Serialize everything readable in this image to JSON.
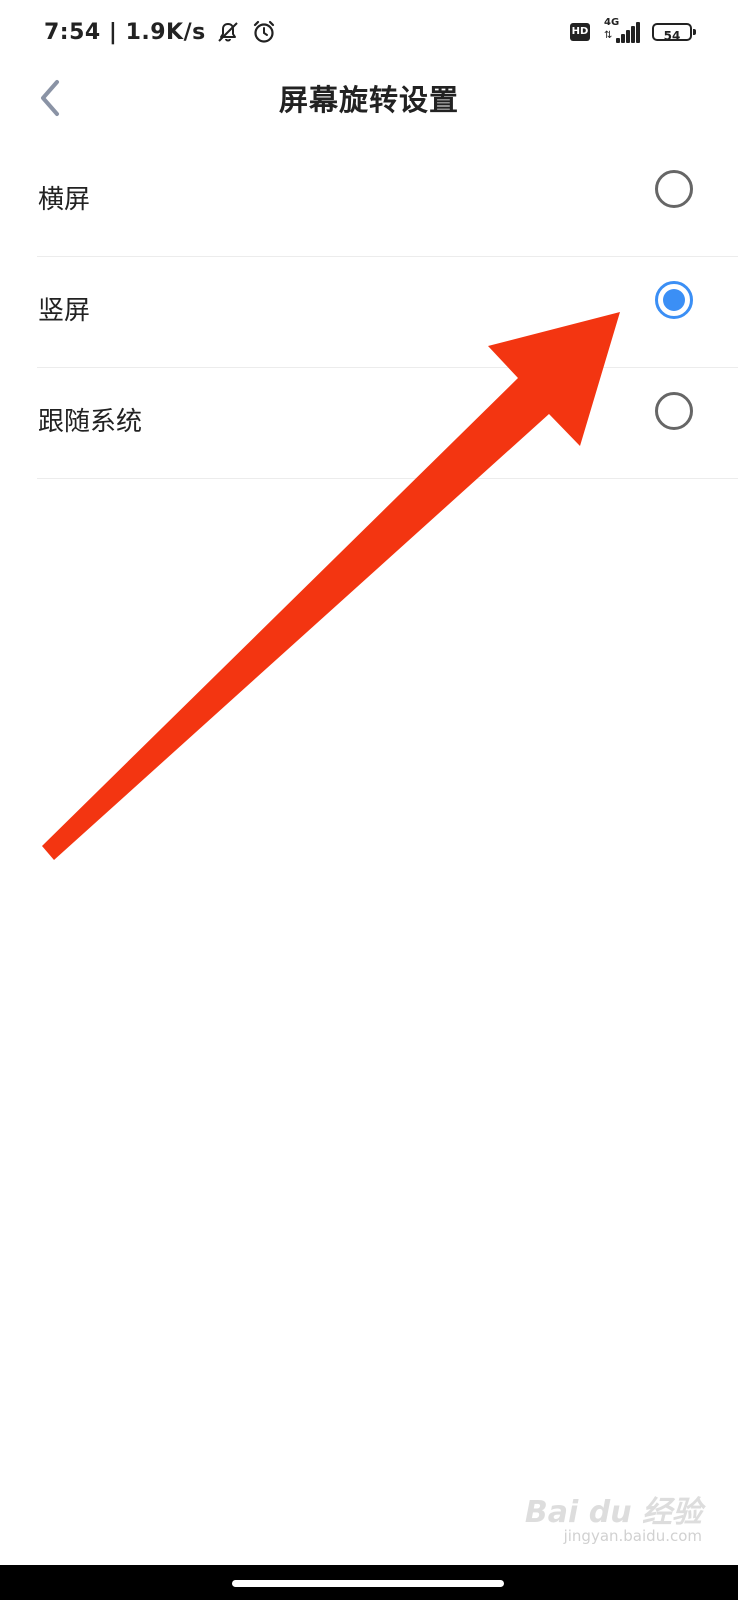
{
  "status_bar": {
    "time_speed": "7:54 | 1.9K/s",
    "network": "4G",
    "network_arrows": "⇅",
    "hd_label": "HD",
    "battery_level": "54",
    "signal_bars": 5
  },
  "header": {
    "title": "屏幕旋转设置",
    "back_icon": "chevron-left-icon"
  },
  "options": [
    {
      "label": "横屏",
      "selected": false
    },
    {
      "label": "竖屏",
      "selected": true
    },
    {
      "label": "跟随系统",
      "selected": false
    }
  ],
  "colors": {
    "accent": "#3b8ff5",
    "annotation_arrow": "#f33511",
    "radio_border": "#666666",
    "divider": "#ececec"
  },
  "watermark": {
    "logo": "Bai du 经验",
    "site": "jingyan.baidu.com"
  }
}
